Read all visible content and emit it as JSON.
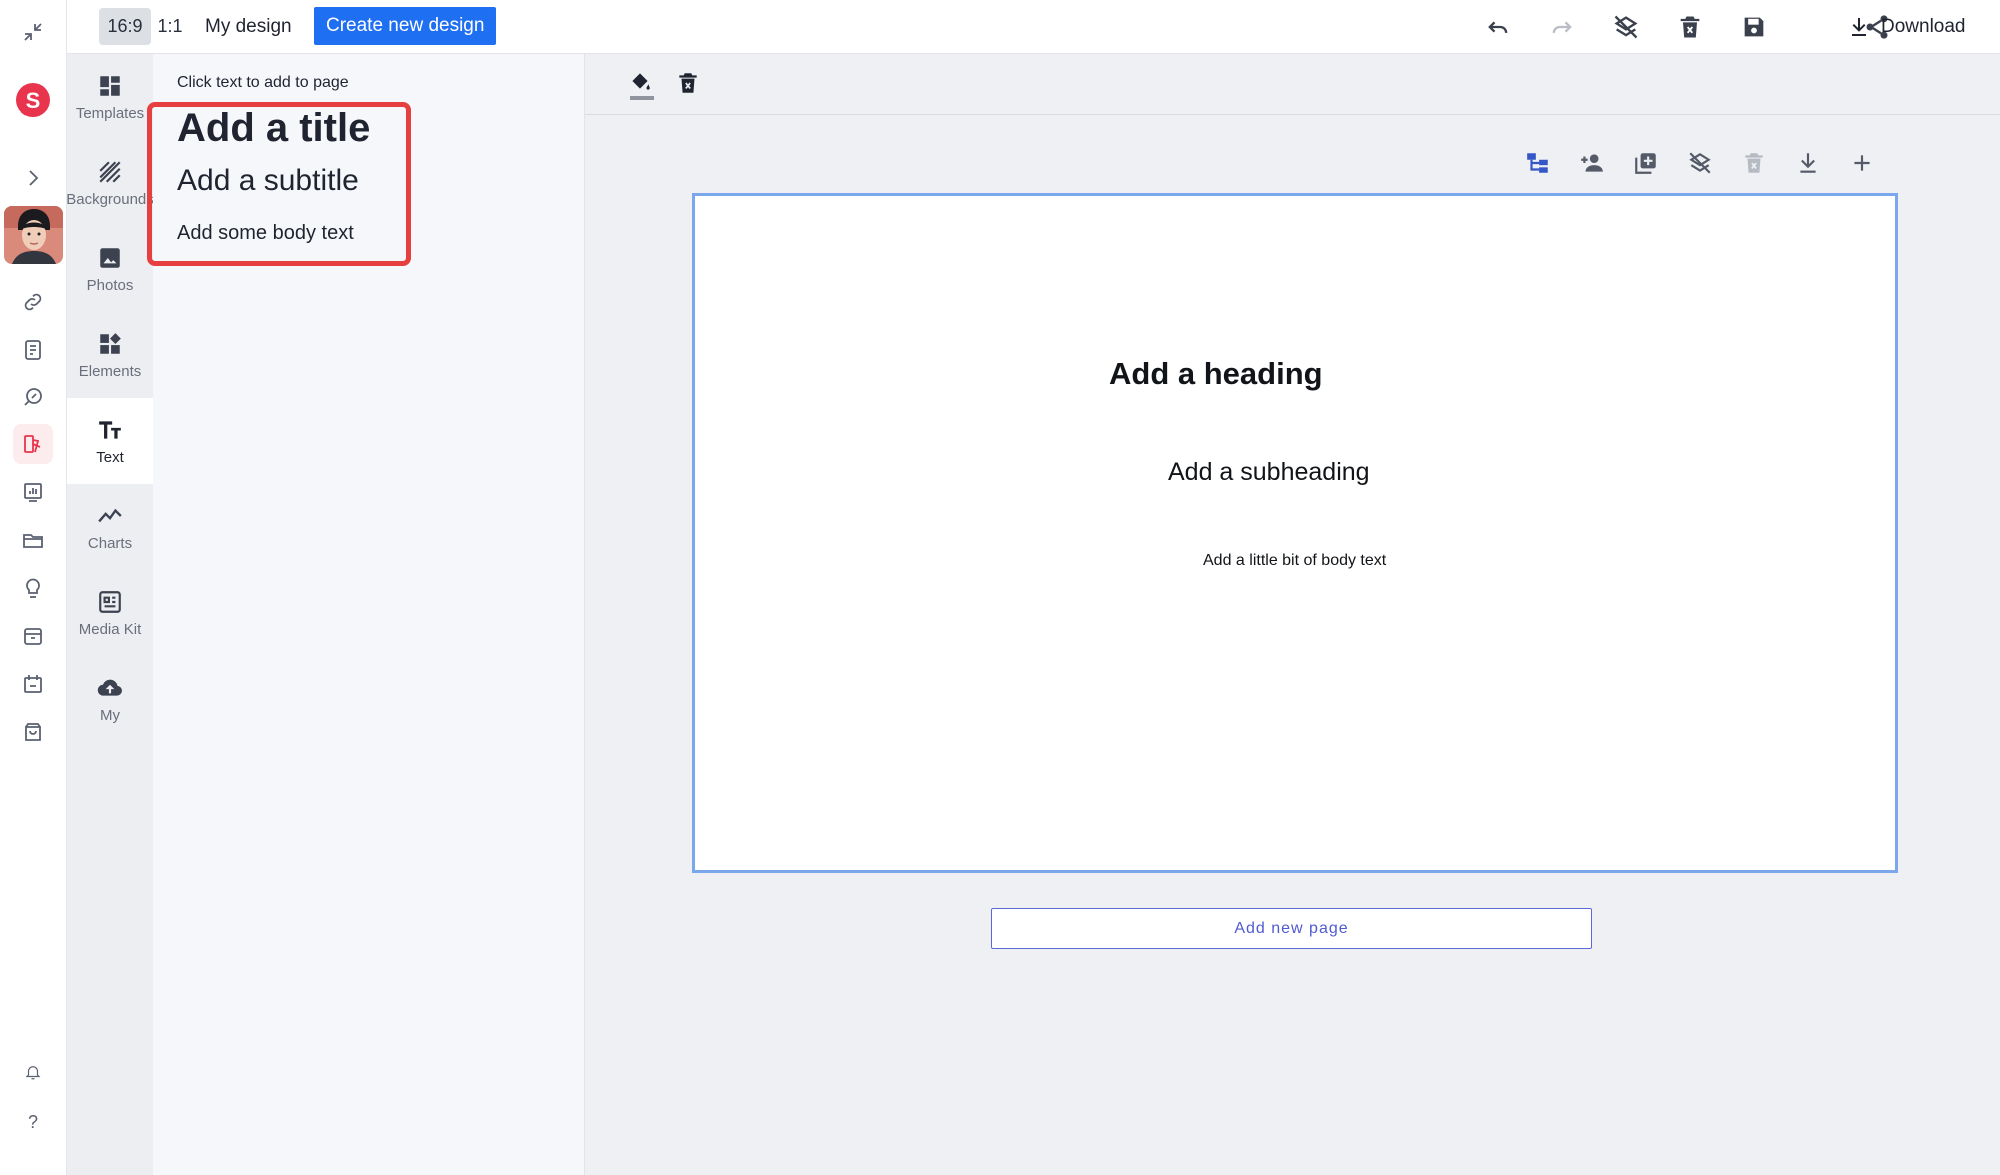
{
  "topbar": {
    "ratio_16_9": "16:9",
    "ratio_1_1": "1:1",
    "design_name": "My design",
    "create_button": "Create new design",
    "download_label": "Download",
    "icons": [
      "undo-icon",
      "redo-icon",
      "clear-layers-icon",
      "delete-icon",
      "save-icon",
      "share-icon",
      "download-icon"
    ]
  },
  "rail": {
    "icons": [
      "collapse-icon",
      "app-logo",
      "expand-icon",
      "avatar",
      "link-icon",
      "notes-icon",
      "explore-icon",
      "design-icon",
      "analytics-icon",
      "folder-icon",
      "lightbulb-icon",
      "archive-icon",
      "calendar-icon",
      "bag-icon",
      "bell-icon",
      "help-icon"
    ],
    "help_label": "?",
    "active_color": "#e8344c"
  },
  "tools": [
    {
      "label": "Templates",
      "icon": "templates-icon"
    },
    {
      "label": "Backgrounds",
      "icon": "backgrounds-icon"
    },
    {
      "label": "Photos",
      "icon": "photos-icon"
    },
    {
      "label": "Elements",
      "icon": "elements-icon"
    },
    {
      "label": "Text",
      "icon": "text-icon",
      "active": true
    },
    {
      "label": "Charts",
      "icon": "charts-icon"
    },
    {
      "label": "Media Kit",
      "icon": "media-kit-icon"
    },
    {
      "label": "My",
      "icon": "cloud-upload-icon"
    }
  ],
  "text_panel": {
    "hint": "Click text to add to page",
    "title": "Add a title",
    "subtitle": "Add a subtitle",
    "body": "Add some body text",
    "highlight_color": "#e5403f"
  },
  "canvas": {
    "toolbar_icons": [
      "fill-color-icon",
      "delete-element-icon"
    ],
    "page_action_icons": [
      "hierarchy-icon",
      "add-person-icon",
      "duplicate-page-icon",
      "clear-layers-icon",
      "delete-page-icon",
      "download-page-icon",
      "add-icon"
    ],
    "page": {
      "heading": "Add a heading",
      "subheading": "Add a subheading",
      "body": "Add a little bit of body text",
      "border_color": "#7ba7ec"
    },
    "add_page_label": "Add new page"
  }
}
